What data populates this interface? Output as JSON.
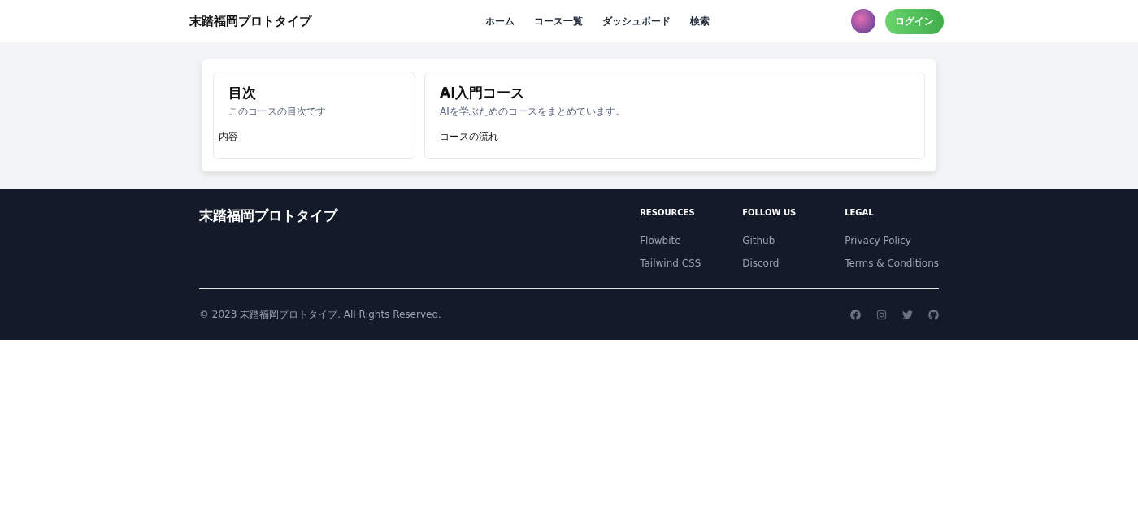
{
  "header": {
    "brand": "末踏福岡プロトタイプ",
    "nav": [
      "ホーム",
      "コース一覧",
      "ダッシュボード",
      "検索"
    ],
    "login": "ログイン"
  },
  "toc": {
    "title": "目次",
    "subtitle": "このコースの目次です",
    "body": "内容"
  },
  "course": {
    "title": "AI入門コース",
    "subtitle": "AIを学ぶためのコースをまとめています。",
    "body": "コースの流れ"
  },
  "footer": {
    "brand": "末踏福岡プロトタイプ",
    "columns": [
      {
        "heading": "RESOURCES",
        "links": [
          "Flowbite",
          "Tailwind CSS"
        ]
      },
      {
        "heading": "FOLLOW US",
        "links": [
          "Github",
          "Discord"
        ]
      },
      {
        "heading": "LEGAL",
        "links": [
          "Privacy Policy",
          "Terms & Conditions"
        ]
      }
    ],
    "copyright": "© 2023 末踏福岡プロトタイプ. All Rights Reserved."
  }
}
